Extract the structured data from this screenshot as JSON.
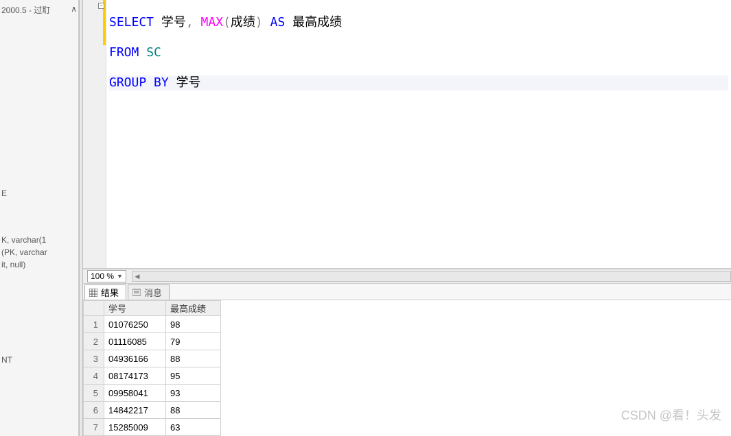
{
  "sidebar": {
    "top_text": "2000.5 - 过耵",
    "mid_line1": "E",
    "mid_line2": "K, varchar(1",
    "mid_line3": "(PK, varchar",
    "mid_line4": "it, null)",
    "bottom_text": "NT",
    "scroll_arrow": "∧"
  },
  "editor": {
    "fold_symbol": "−",
    "line1": {
      "select": "SELECT",
      "col1": " 学号",
      "comma": ",",
      "max": " MAX",
      "paren_open": "(",
      "col2": "成绩",
      "paren_close": ")",
      "as": " AS",
      "alias": " 最高成绩"
    },
    "line2": {
      "from": "FROM",
      "table": " SC"
    },
    "line3": {
      "groupby": "GROUP BY",
      "col": " 学号"
    }
  },
  "zoom": {
    "value": "100 %"
  },
  "tabs": {
    "results_label": "结果",
    "messages_label": "消息"
  },
  "results": {
    "headers": {
      "rownum": "",
      "col1": "学号",
      "col2": "最高成绩"
    },
    "rows": [
      {
        "n": "1",
        "id": "01076250",
        "score": "98"
      },
      {
        "n": "2",
        "id": "01116085",
        "score": "79"
      },
      {
        "n": "3",
        "id": "04936166",
        "score": "88"
      },
      {
        "n": "4",
        "id": "08174173",
        "score": "95"
      },
      {
        "n": "5",
        "id": "09958041",
        "score": "93"
      },
      {
        "n": "6",
        "id": "14842217",
        "score": "88"
      },
      {
        "n": "7",
        "id": "15285009",
        "score": "63"
      }
    ]
  },
  "watermark": "CSDN @看！头发"
}
